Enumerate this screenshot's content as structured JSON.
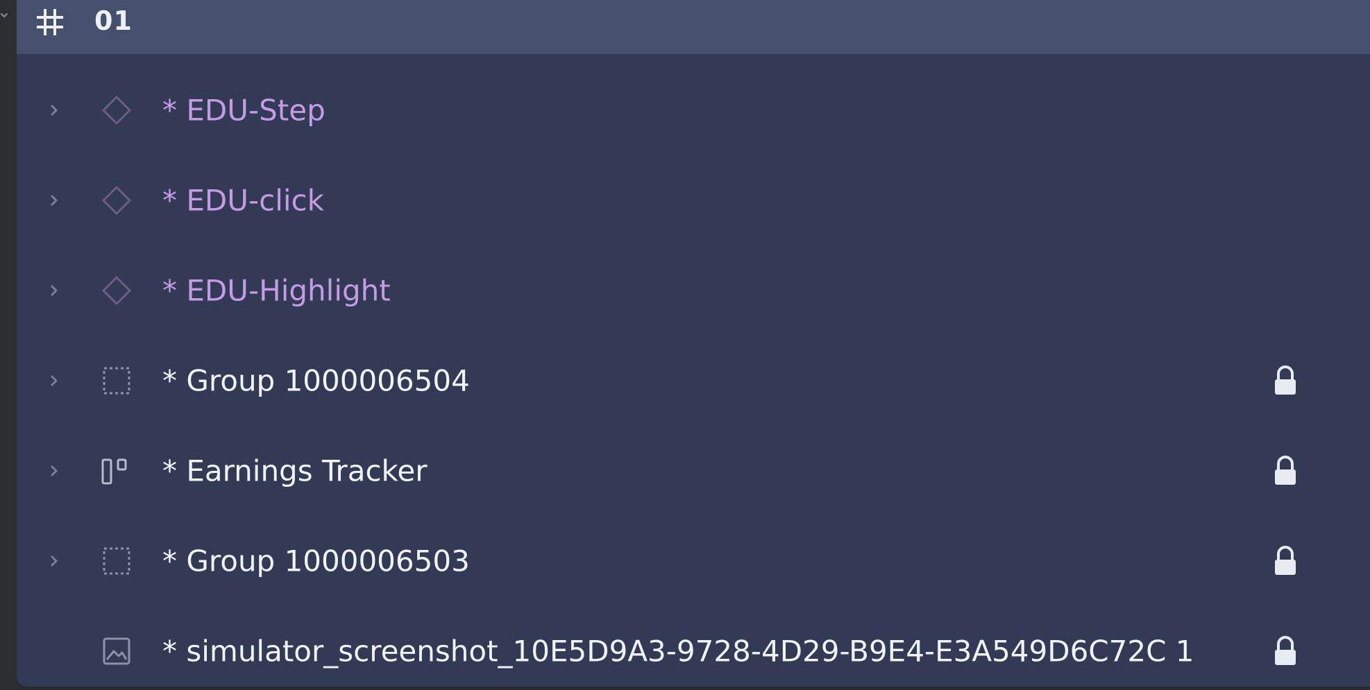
{
  "header": {
    "title": "01",
    "icon": "frame-hash-icon"
  },
  "layers": [
    {
      "label": "* EDU-Step",
      "kind": "component",
      "icon": "component-diamond-icon",
      "expandable": true,
      "locked": false
    },
    {
      "label": "* EDU-click",
      "kind": "component",
      "icon": "component-diamond-icon",
      "expandable": true,
      "locked": false
    },
    {
      "label": "* EDU-Highlight",
      "kind": "component",
      "icon": "component-diamond-icon",
      "expandable": true,
      "locked": false
    },
    {
      "label": "* Group 1000006504",
      "kind": "group",
      "icon": "group-dashed-square-icon",
      "expandable": true,
      "locked": true
    },
    {
      "label": "* Earnings Tracker",
      "kind": "auto-layout",
      "icon": "auto-layout-icon",
      "expandable": true,
      "locked": true
    },
    {
      "label": "* Group 1000006503",
      "kind": "group",
      "icon": "group-dashed-square-icon",
      "expandable": true,
      "locked": true
    },
    {
      "label": "* simulator_screenshot_10E5D9A3-9728-4D29-B9E4-E3A549D6C72C 1",
      "kind": "image",
      "icon": "image-icon",
      "expandable": false,
      "locked": true
    }
  ],
  "colors": {
    "panel_bg": "#323a55",
    "header_bg": "#44506e",
    "component_text": "#c79ae6",
    "default_text": "#f2f3f7"
  }
}
